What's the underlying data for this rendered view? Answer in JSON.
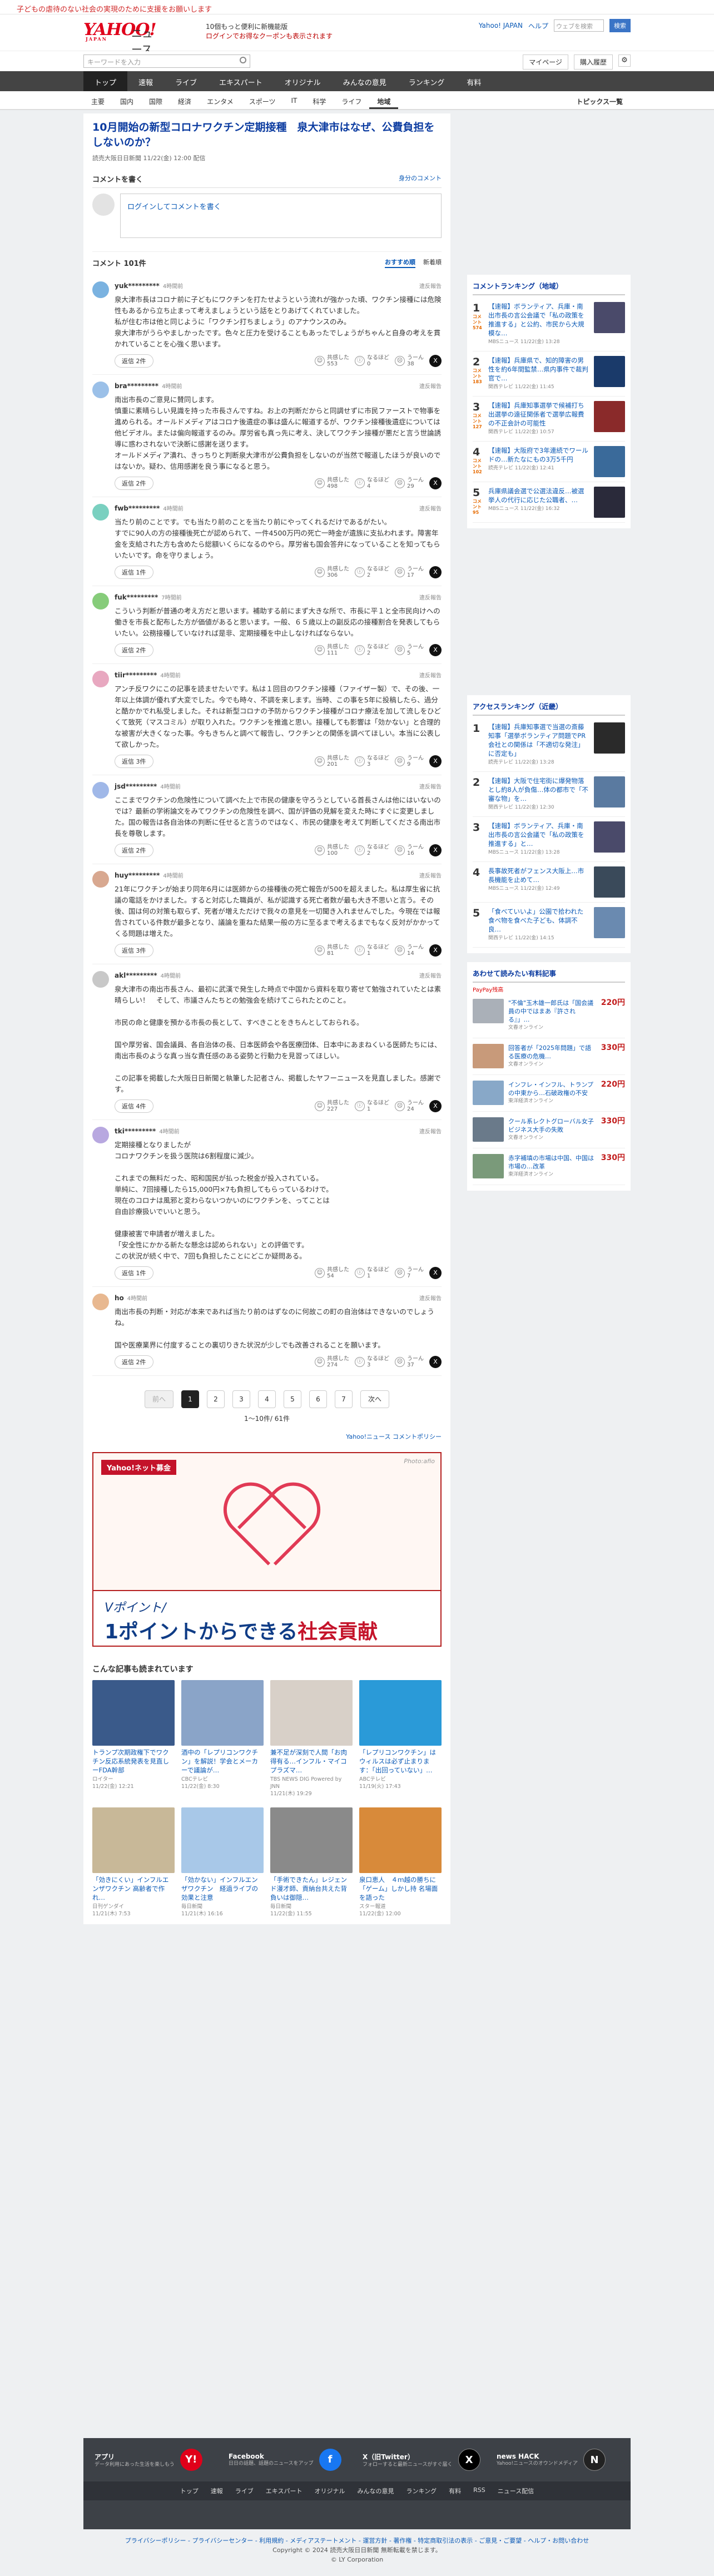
{
  "top_notice": "子どもの虐待のない社会の実現のために支援をお願いします",
  "header": {
    "logo": "YAHOO!",
    "logo_sub": "JAPAN",
    "section": "ニュース",
    "promo_line1": "10個もっと便利に新機能版",
    "promo_line2": "ログインでお得なクーポンも表示されます",
    "links": [
      "Yahoo! JAPAN",
      "ヘルプ"
    ],
    "search_placeholder": "ウェブを検索",
    "search_btn": "検索"
  },
  "searchbar": {
    "placeholder": "キーワードを入力",
    "mypage": "マイページ",
    "login": "購入履歴"
  },
  "gnav": [
    "トップ",
    "速報",
    "ライブ",
    "エキスパート",
    "オリジナル",
    "みんなの意見",
    "ランキング",
    "有料"
  ],
  "snav": [
    "主要",
    "国内",
    "国際",
    "経済",
    "エンタメ",
    "スポーツ",
    "IT",
    "科学",
    "ライフ",
    "地域"
  ],
  "snav_right": "トピックス一覧",
  "article": {
    "title": "10月開始の新型コロナワクチン定期接種　泉大津市はなぜ、公費負担をしないのか？",
    "source": "読売大阪日日新聞  11/22(金) 12:00 配信"
  },
  "comment_form": {
    "heading": "コメントを書く",
    "policy": "身分のコメント",
    "placeholder": "ログインしてコメントを書く"
  },
  "comments_header": {
    "count": "コメント 101件",
    "sort1": "おすすめ順",
    "sort2": "新着順"
  },
  "comments": [
    {
      "user": "yuk*********",
      "time": "4時間前",
      "text": "泉大津市長はコロナ前に子どもにワクチンを打たせようという流れが強かった頃、ワクチン接種には危険性もあるから立ち止まって考えましょうという話をとりあげてくれていました。\n私が住む市は他と同じように「ワクチン打ちましょう」のアナウンスのみ。\n泉大津市がうらやましかったです。色々と圧力を受けることもあったでしょうがちゃんと自身の考えを貫かれていることを心強く思います。",
      "reply": "返信 2件",
      "up": "553",
      "mid": "0",
      "down": "38",
      "color": "#7ab2e0"
    },
    {
      "user": "bra*********",
      "time": "4時間前",
      "text": "南出市長のご意見に賛同します。\n慎重に素晴らしい見識を持った市長さんですね。お上の判断だからと同調せずに市民ファーストで物事を進められる。オールドメディアはコロナ後遺症の事は盛んに報道するが、ワクチン接種後遺症については他ビデオル。または偏向報道するのみ。厚労省も真っ先に考え、決してワクチン接種が悪だと言う世論誘導に惑わされないで決断に感謝を送ります。\nオールドメディア潰れ、きっちりと判断泉大津市が公費負担をしないのが当然で報道したほうが良いのではないか。疑わ、信用感謝を良う事になると思う。",
      "reply": "返信 2件",
      "up": "498",
      "mid": "4",
      "down": "29",
      "color": "#9bc0e8"
    },
    {
      "user": "fwb*********",
      "time": "4時間前",
      "text": "当たり前のことです。でも当たり前のことを当たり前にやってくれるだけであるがたい。\nすでに90人の方の接種後死亡が認められて、一件4500万円の死亡一時金が遺族に支払われます。障害年金を支給された方も含めたら総額いくらになるのやら。厚労省も国会答弁になっていることを知ってもらいたいです。命を守りましょう。",
      "reply": "返信 1件",
      "up": "306",
      "mid": "2",
      "down": "17",
      "color": "#7ad0c0"
    },
    {
      "user": "fuk*********",
      "time": "7時間前",
      "text": "こういう判断が普通の考え方だと思います。補助する前にまず大きな所で、市長に平１と全市民向けへの働きを市長と配布した方が価値があると思います。一般、６５歳以上の副反応の接種割合を発表してもらいたい。公務接種していなければ是非、定期接種を中止しなければならない。",
      "reply": "返信 2件",
      "up": "111",
      "mid": "2",
      "down": "5",
      "color": "#86cc7a"
    },
    {
      "user": "tiir*********",
      "time": "4時間前",
      "text": "アンチ反ワクにこの記事を読ませたいです。私は１回目のワクチン接種（ファイザー製）で、その後、一年以上体調が優れず大変でした。今でも時々、不調を来します。当時、この事を5年に投稿したら、過分と酷かかでれ私受しました。それは新型コロナの予防からワクチン接種がコロナ療法を加して流しをひどくて致死（マスコミル）が取り入れた。ワクチンを推進と思い。接種しても影響は「効かない」と合理的な被害が大きくなった事。今もきちんと調べて報告し、ワクチンとの関係を調べてほしい。本当に公表して欲しかった。",
      "reply": "返信 3件",
      "up": "201",
      "mid": "3",
      "down": "9",
      "color": "#e8a8c0"
    },
    {
      "user": "jsd*********",
      "time": "4時間前",
      "text": "ここまでワクチンの危険性について調べた上で市民の健康を守ろうとしている首長さんは他にはいないのでは？最新の学術論文をみてワクチンの危険性を調べ、国が評価の見解を変えた時にすぐに変更しました。国の報告は各自治体の判断に任せると言うのではなく、市民の健康を考えて判断してくださる南出市長を尊敬します。",
      "reply": "返信 2件",
      "up": "100",
      "mid": "2",
      "down": "16",
      "color": "#a0b8e8"
    },
    {
      "user": "huy*********",
      "time": "4時間前",
      "text": "21年にワクチンが始まり同年6月には医師からの接種後の死亡報告が500を超えました。私は厚生省に抗議の電話をかけました。すると対応した職員が、私が認識する死亡者数が最も大き不思いと言う。その後、国は何の対策も取らず、死者が増えただけで我々の意見を一切聞き入れませんでした。今現在では報告されている件数が最多となり、議論を重ねた結果一般の方に至るまで考えるまでもなく反対がかかってくる問題は増えた。",
      "reply": "返信 3件",
      "up": "81",
      "mid": "1",
      "down": "14",
      "color": "#d8a890"
    },
    {
      "user": "akl*********",
      "time": "4時間前",
      "text": "泉大津市の南出市長さん、最初に武漢で発生した時点で中国から資料を取り寄せて勉強されていたとは素晴らしい！　そして、市議さんたちとの勉強会を続けてこられたとのこと。\n\n市民の命と健康を預かる市長の長として、すべきことをきちんとしておられる。\n\n国や厚労省、国会議員、各自治体の長、日本医師会や各医療団体、日本中にあまねくいる医師たちには、南出市長のような真っ当な責任感のある姿勢と行動力を見習ってほしい。\n\nこの記事を掲載した大阪日日新聞と執筆した記者さん、掲載したヤフーニュースを見直しました。感謝です。",
      "reply": "返信 4件",
      "up": "227",
      "mid": "1",
      "down": "24",
      "color": "#c8c8c8"
    },
    {
      "user": "tki*********",
      "time": "4時間前",
      "text": "定期接種となりましたが\nコロナワクチンを扱う医院は6割程度に減少。\n\nこれまでの無料だった、昭和国民が払った税金が投入されている。\n単純に、7回接種したら15,000円×7も負担してもらっているわけで。\n現在のコロナは風邪と変わらないつかいのにワクチンを、ってことは\n自由診療扱いでいいと思う。\n\n健康被害で申請者が増えました。\n「安全性にかかる新たな懸念は認められない」との評価です。\nこの状況が続く中で、7回も負担したことにどこか疑問ある。",
      "reply": "返信 1件",
      "up": "54",
      "mid": "1",
      "down": "7",
      "color": "#b8a8e0"
    },
    {
      "user": "ho",
      "time": "4時間前",
      "text": "南出市長の判断・対応が本来であれば当たり前のはずなのに何故この町の自治体はできないのでしょうね。\n\n国や医療業界に付度することの裏切りきた状況が少しでも改善されることを願います。",
      "reply": "返信 2件",
      "up": "274",
      "mid": "3",
      "down": "37",
      "color": "#e8b890"
    }
  ],
  "vote_labels": {
    "up": "共感した",
    "mid": "なるほど",
    "down": "うーん"
  },
  "pager": {
    "prev": "前へ",
    "pages": [
      "1",
      "2",
      "3",
      "4",
      "5",
      "6",
      "7"
    ],
    "next": "次へ",
    "count": "1〜10件/ 61件"
  },
  "policy_link": "Yahoo!ニュース コメントポリシー",
  "banner": {
    "brand": "Yahoo!ネット募金",
    "photo": "Photo:afio",
    "line1": "Vポイント/",
    "line2a": "1ポイントからできる",
    "line2b": "社会貢献"
  },
  "related": {
    "heading": "こんな記事も読まれています",
    "items": [
      {
        "cap": "トランプ次期政権下でワクチン反応系統発表を見直しーFDA幹部",
        "meta": "ロイター\n11/22(金) 12:21",
        "color": "#3a5a8a"
      },
      {
        "cap": "酒中の「レプリコンワクチン」を解説！学会とメーカーで議論が…",
        "meta": "CBCテレビ\n11/22(金) 8:30",
        "color": "#8aa4c8"
      },
      {
        "cap": "兼不足が深刻で人間「お肉得有る…インフル・マイコプラズマ…",
        "meta": "TBS NEWS DIG Powered by JNN\n11/21(木) 19:29",
        "color": "#d8d0c8"
      },
      {
        "cap": "「レプリコンワクチン」はウィルスは必ず止まります：「出回っていない」…",
        "meta": "ABCテレビ\n11/19(火) 17:43",
        "color": "#2a9ad8"
      },
      {
        "cap": "「効きにくい」インフルエンザワクチン 高齢者で作れ…",
        "meta": "日刊ゲンダイ\n11/21(木) 7:53",
        "color": "#c8b898"
      },
      {
        "cap": "「効かない」インフルエンザワクチン　経過ライブの効果と注意",
        "meta": "毎日新聞\n11/21(木) 16:16",
        "color": "#a8c8e8"
      },
      {
        "cap": "「手術できたん」レジェンド漫才師、貢納台共えた背負いは御隠…",
        "meta": "毎日新聞\n11/22(金) 11:55",
        "color": "#8a8a8a"
      },
      {
        "cap": "泉口恵人　４ｍ越の勝ちに「ゲーム」しかし持 名場面を語った",
        "meta": "スター報道\n11/22(金) 12:00",
        "color": "#d88a3a"
      }
    ]
  },
  "side": {
    "ranking_title": "コメントランキング（地域）",
    "ranking": [
      {
        "n": "1",
        "badge": "コメント",
        "cnt": "574",
        "text": "【速報】ボランティア、兵庫・南出市長の言公会議で「私の政策を推進する」と公約、市民から大規模な…",
        "meta": "MBSニュース 11/22(金) 13:28",
        "color": "#4a4a6a"
      },
      {
        "n": "2",
        "badge": "コメント",
        "cnt": "183",
        "text": "【速報】兵庫県で、知的障害の男性を約6年間監禁…県内事件で裁判官で…",
        "meta": "関西テレビ 11/22(金) 11:45",
        "color": "#1a3a6a"
      },
      {
        "n": "3",
        "badge": "コメント",
        "cnt": "127",
        "text": "【速報】兵庫知事選挙で候補打ち出選挙の遠征関係者で選挙広報費の不正会計の可能性",
        "meta": "関西テレビ 11/22(金) 10:57",
        "color": "#8a2a2a"
      },
      {
        "n": "4",
        "badge": "コメント",
        "cnt": "102",
        "text": "【速報】大阪府で3年連続でワールドの…新たなにもの3万5千円",
        "meta": "読売テレビ 11/22(金) 12:41",
        "color": "#3a6a9a"
      },
      {
        "n": "5",
        "badge": "コメント",
        "cnt": "95",
        "text": "兵庫県議会選で公選法違反…被選挙人の代行に応じた公職者、…",
        "meta": "MBSニュース 11/22(金) 16:32",
        "color": "#2a2a3a"
      }
    ],
    "access_title": "アクセスランキング（近畿）",
    "access": [
      {
        "n": "1",
        "text": "【速報】兵庫知事選で当選の斎藤知事「選挙ボランティア問題でPR会社との関係は「不適切な発注」に否定も」",
        "meta": "読売テレビ 11/22(金) 13:28",
        "color": "#2a2a2a"
      },
      {
        "n": "2",
        "text": "【速報】大阪で住宅街に爆発物落とし約8人が負傷…体の都市で「不審な物」を…",
        "meta": "関西テレビ 11/22(金) 12:30",
        "color": "#5a7aa0"
      },
      {
        "n": "3",
        "text": "【速報】ボランティア、兵庫・南出市長の言公会議で「私の政策を推進する」と…",
        "meta": "MBSニュース 11/22(金) 13:28",
        "color": "#4a4a6a"
      },
      {
        "n": "4",
        "text": "長事故死者がフェンス大阪上…市長機能を止めて…",
        "meta": "MBSニュース 11/22(金) 12:49",
        "color": "#3a4a5a"
      },
      {
        "n": "5",
        "text": "「食べていいよ」公園で拾われた食べ物を食べた子ども、体調不良…",
        "meta": "関西テレビ 11/22(金) 14:15",
        "color": "#6a8ab0"
      }
    ],
    "ads_title": "あわせて読みたい有料記事",
    "ads_badge": "PayPay残高",
    "ads": [
      {
        "text": "\"不倫\"玉木雄一郎氏は「国会議員の中ではまあ『許される』」…",
        "meta": "文春オンライン",
        "price": "220",
        "color": "#aab0b8"
      },
      {
        "text": "回答者が「2025年問題」で語る医療の危機…",
        "meta": "文春オンライン",
        "price": "330",
        "color": "#c89a7a"
      },
      {
        "text": "インフレ・インフル、トランプの中東から…石破政権の不安",
        "meta": "東洋経済オンライン",
        "price": "220",
        "color": "#88a8c8"
      },
      {
        "text": "クール系レクトグローバル女子ビジネス大手の失敗",
        "meta": "文春オンライン",
        "price": "330",
        "color": "#6a7a8a"
      },
      {
        "text": "赤字補填の市場は中国、中国は市場の…改革",
        "meta": "東洋経済オンライン",
        "price": "330",
        "color": "#7a9a7a"
      }
    ],
    "yen": "円"
  },
  "footer": {
    "apps": [
      {
        "t": "アプリ",
        "d": "データ利用にあった生活を楽しもう",
        "icon": "Y!",
        "ic": "#e0001a"
      },
      {
        "t": "Facebook",
        "d": "日日の話題、話題のニュースをアップ",
        "icon": "f",
        "ic": "#1877f2"
      },
      {
        "t": "X（旧Twitter）",
        "d": "フォローすると最新ニュースがすぐ届く",
        "icon": "X",
        "ic": "#000"
      },
      {
        "t": "news HACK",
        "d": "Yahoo!ニュースのオウンドメディア",
        "icon": "N",
        "ic": "#222"
      }
    ],
    "links": [
      "トップ",
      "速報",
      "ライブ",
      "エキスパート",
      "オリジナル",
      "みんなの意見",
      "ランキング",
      "有料",
      "RSS",
      "ニュース配信"
    ]
  },
  "bottom": {
    "line1": "プライバシーポリシー - プライバシーセンター - 利用規約 - メディアステートメント - 運営方針 - 著作権 - 特定商取引法の表示 - ご意見・ご要望 - ヘルプ・お問い合わせ",
    "line2": "Copyright © 2024 読売大阪日日新聞 無断転載を禁じます。",
    "line3": "© LY Corporation"
  }
}
